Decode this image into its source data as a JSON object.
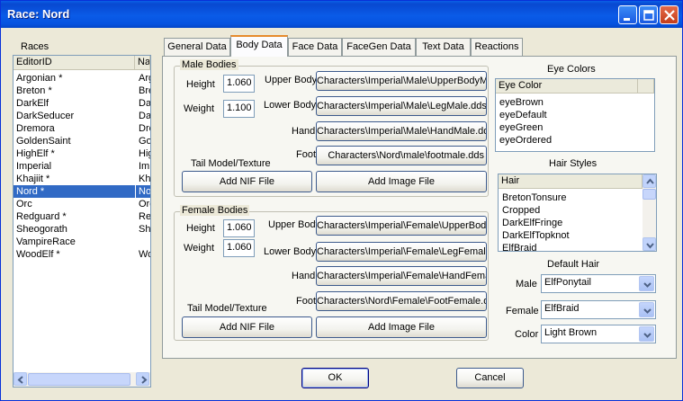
{
  "window": {
    "title": "Race: Nord"
  },
  "races_panel": {
    "label": "Races",
    "columns": [
      "EditorID",
      "Na"
    ],
    "rows": [
      {
        "id": "Argonian *",
        "name": "Arg"
      },
      {
        "id": "Breton *",
        "name": "Bre"
      },
      {
        "id": "DarkElf",
        "name": "Da"
      },
      {
        "id": "DarkSeducer",
        "name": "Da"
      },
      {
        "id": "Dremora",
        "name": "Dre"
      },
      {
        "id": "GoldenSaint",
        "name": "Go"
      },
      {
        "id": "HighElf *",
        "name": "Hig"
      },
      {
        "id": "Imperial",
        "name": "Imp"
      },
      {
        "id": "Khajiit *",
        "name": "Kh"
      },
      {
        "id": "Nord *",
        "name": "No"
      },
      {
        "id": "Orc",
        "name": "Orc"
      },
      {
        "id": "Redguard *",
        "name": "Re"
      },
      {
        "id": "Sheogorath",
        "name": "Sh"
      },
      {
        "id": "VampireRace",
        "name": ""
      },
      {
        "id": "WoodElf *",
        "name": "Wo"
      }
    ],
    "selected_index": 9
  },
  "tabs": [
    "General Data",
    "Body Data",
    "Face Data",
    "FaceGen Data",
    "Text Data",
    "Reactions"
  ],
  "active_tab": "Body Data",
  "male": {
    "group_title": "Male Bodies",
    "height_label": "Height",
    "height": "1.060",
    "weight_label": "Weight",
    "weight": "1.100",
    "upper_label": "Upper Body",
    "upper_path": "Characters\\Imperial\\Male\\UpperBodyMale.dds",
    "lower_label": "Lower Body",
    "lower_path": "Characters\\Imperial\\Male\\LegMale.dds",
    "hand_label": "Hand",
    "hand_path": "Characters\\Imperial\\Male\\HandMale.dds",
    "foot_label": "Foot",
    "foot_path": "Characters\\Nord\\male\\footmale.dds",
    "tail_label": "Tail Model/Texture",
    "add_nif": "Add NIF File",
    "add_image": "Add Image File"
  },
  "female": {
    "group_title": "Female Bodies",
    "height_label": "Height",
    "height": "1.060",
    "weight_label": "Weight",
    "weight": "1.060",
    "upper_label": "Upper Body",
    "upper_path": "Characters\\Imperial\\Female\\UpperBodyFemale.dds",
    "lower_label": "Lower Body",
    "lower_path": "Characters\\Imperial\\Female\\LegFemale.dds",
    "hand_label": "Hand",
    "hand_path": "Characters\\Imperial\\Female\\HandFemale.dds",
    "foot_label": "Foot",
    "foot_path": "Characters\\Nord\\Female\\FootFemale.dds",
    "tail_label": "Tail Model/Texture",
    "add_nif": "Add NIF File",
    "add_image": "Add Image File"
  },
  "eye_colors": {
    "title": "Eye Colors",
    "header": "Eye Color",
    "items": [
      "eyeBrown",
      "eyeDefault",
      "eyeGreen",
      "eyeOrdered"
    ]
  },
  "hair_styles": {
    "title": "Hair Styles",
    "header": "Hair",
    "items": [
      "BretonTonsure",
      "Cropped",
      "DarkElfFringe",
      "DarkElfTopknot",
      "ElfBraid"
    ]
  },
  "default_hair": {
    "title": "Default Hair",
    "male_label": "Male",
    "male_value": "ElfPonytail",
    "female_label": "Female",
    "female_value": "ElfBraid",
    "color_label": "Color",
    "color_value": "Light Brown"
  },
  "footer": {
    "ok": "OK",
    "cancel": "Cancel"
  }
}
